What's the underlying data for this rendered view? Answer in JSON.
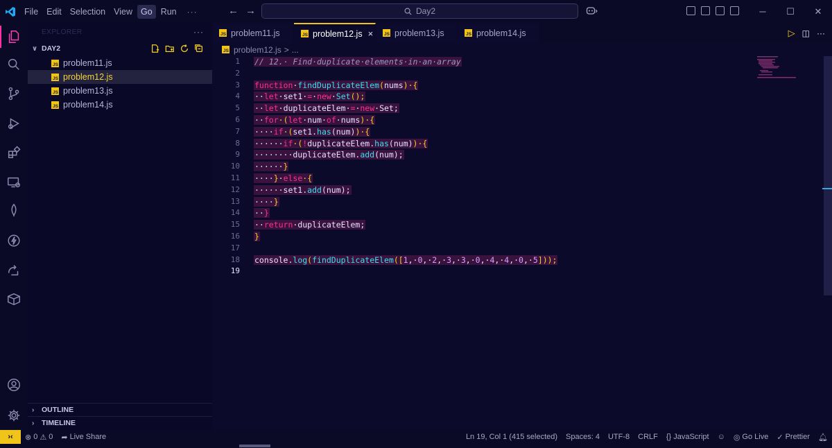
{
  "window": {
    "menu": [
      "File",
      "Edit",
      "Selection",
      "View",
      "Go",
      "Run"
    ],
    "active_menu": "Go",
    "more": "···",
    "search_text": "Day2",
    "nav_back": "←",
    "nav_forward": "→"
  },
  "sidebar": {
    "header_title": "EXPLORER",
    "more": "···",
    "folder_name": "DAY2",
    "files": [
      {
        "name": "problem11.js",
        "selected": false
      },
      {
        "name": "problem12.js",
        "selected": true
      },
      {
        "name": "problem13.js",
        "selected": false
      },
      {
        "name": "problem14.js",
        "selected": false
      }
    ],
    "outline_label": "OUTLINE",
    "timeline_label": "TIMELINE"
  },
  "tabs": [
    {
      "name": "problem11.js",
      "active": false
    },
    {
      "name": "problem12.js",
      "active": true
    },
    {
      "name": "problem13.js",
      "active": false
    },
    {
      "name": "problem14.js",
      "active": false
    }
  ],
  "tab_close": "×",
  "breadcrumb": {
    "file": "problem12.js",
    "sep": ">",
    "rest": "..."
  },
  "editor": {
    "current_line": 19,
    "line_numbers": [
      "1",
      "2",
      "3",
      "4",
      "5",
      "6",
      "7",
      "8",
      "9",
      "10",
      "11",
      "12",
      "13",
      "14",
      "15",
      "16",
      "17",
      "18",
      "19"
    ],
    "lines": [
      [
        {
          "t": "// 12.· Find·duplicate·elements·in·an·array",
          "c": "cmt"
        }
      ],
      [],
      [
        {
          "t": "function",
          "c": "kw"
        },
        {
          "t": "·",
          "c": "id"
        },
        {
          "t": "findDuplicateElem",
          "c": "fn"
        },
        {
          "t": "(",
          "c": "pun"
        },
        {
          "t": "nums",
          "c": "id"
        },
        {
          "t": ")",
          "c": "pun"
        },
        {
          "t": "·{",
          "c": "pun"
        }
      ],
      [
        {
          "t": "··",
          "c": "id"
        },
        {
          "t": "let",
          "c": "kw"
        },
        {
          "t": "·set1·",
          "c": "id"
        },
        {
          "t": "=",
          "c": "op"
        },
        {
          "t": "·",
          "c": "id"
        },
        {
          "t": "new",
          "c": "kw"
        },
        {
          "t": "·",
          "c": "id"
        },
        {
          "t": "Set",
          "c": "fn"
        },
        {
          "t": "();",
          "c": "pun"
        }
      ],
      [
        {
          "t": "··",
          "c": "id"
        },
        {
          "t": "let",
          "c": "kw"
        },
        {
          "t": "·duplicateElem·",
          "c": "id"
        },
        {
          "t": "=",
          "c": "op"
        },
        {
          "t": "·",
          "c": "id"
        },
        {
          "t": "new",
          "c": "kw"
        },
        {
          "t": "·Set;",
          "c": "id"
        }
      ],
      [
        {
          "t": "··",
          "c": "id"
        },
        {
          "t": "for",
          "c": "kw"
        },
        {
          "t": "·(",
          "c": "pun"
        },
        {
          "t": "let",
          "c": "kw"
        },
        {
          "t": "·num·",
          "c": "id"
        },
        {
          "t": "of",
          "c": "kw"
        },
        {
          "t": "·nums",
          "c": "id"
        },
        {
          "t": ")·{",
          "c": "pun"
        }
      ],
      [
        {
          "t": "····",
          "c": "id"
        },
        {
          "t": "if",
          "c": "kw"
        },
        {
          "t": "·(",
          "c": "pun"
        },
        {
          "t": "set1.",
          "c": "id"
        },
        {
          "t": "has",
          "c": "fn"
        },
        {
          "t": "(num)",
          "c": "id"
        },
        {
          "t": ")·{",
          "c": "pun"
        }
      ],
      [
        {
          "t": "······",
          "c": "id"
        },
        {
          "t": "if",
          "c": "kw"
        },
        {
          "t": "·(",
          "c": "pun"
        },
        {
          "t": "!",
          "c": "op"
        },
        {
          "t": "duplicateElem.",
          "c": "id"
        },
        {
          "t": "has",
          "c": "fn"
        },
        {
          "t": "(num)",
          "c": "id"
        },
        {
          "t": ")·{",
          "c": "pun"
        }
      ],
      [
        {
          "t": "········duplicateElem.",
          "c": "id"
        },
        {
          "t": "add",
          "c": "fn"
        },
        {
          "t": "(num);",
          "c": "id"
        }
      ],
      [
        {
          "t": "······",
          "c": "id"
        },
        {
          "t": "}",
          "c": "pun"
        }
      ],
      [
        {
          "t": "····",
          "c": "id"
        },
        {
          "t": "}",
          "c": "pun"
        },
        {
          "t": "·",
          "c": "id"
        },
        {
          "t": "else",
          "c": "kw"
        },
        {
          "t": "·{",
          "c": "pun"
        }
      ],
      [
        {
          "t": "······set1.",
          "c": "id"
        },
        {
          "t": "add",
          "c": "fn"
        },
        {
          "t": "(num);",
          "c": "id"
        }
      ],
      [
        {
          "t": "····",
          "c": "id"
        },
        {
          "t": "}",
          "c": "pun"
        }
      ],
      [
        {
          "t": "··",
          "c": "id"
        },
        {
          "t": "}",
          "c": "op"
        }
      ],
      [
        {
          "t": "··",
          "c": "id"
        },
        {
          "t": "return",
          "c": "kw"
        },
        {
          "t": "·duplicateElem;",
          "c": "id"
        }
      ],
      [
        {
          "t": "}",
          "c": "pun"
        }
      ],
      [],
      [
        {
          "t": "console.",
          "c": "id"
        },
        {
          "t": "log",
          "c": "fn"
        },
        {
          "t": "(",
          "c": "pun"
        },
        {
          "t": "findDuplicateElem",
          "c": "fn"
        },
        {
          "t": "([",
          "c": "pun"
        },
        {
          "t": "1",
          "c": "num"
        },
        {
          "t": ",·",
          "c": "id"
        },
        {
          "t": "0",
          "c": "num"
        },
        {
          "t": ",·",
          "c": "id"
        },
        {
          "t": "2",
          "c": "num"
        },
        {
          "t": ",·",
          "c": "id"
        },
        {
          "t": "3",
          "c": "num"
        },
        {
          "t": ",·",
          "c": "id"
        },
        {
          "t": "3",
          "c": "num"
        },
        {
          "t": ",·",
          "c": "id"
        },
        {
          "t": "0",
          "c": "num"
        },
        {
          "t": ",·",
          "c": "id"
        },
        {
          "t": "4",
          "c": "num"
        },
        {
          "t": ",·",
          "c": "id"
        },
        {
          "t": "4",
          "c": "num"
        },
        {
          "t": ",·",
          "c": "id"
        },
        {
          "t": "0",
          "c": "num"
        },
        {
          "t": ",·",
          "c": "id"
        },
        {
          "t": "5",
          "c": "num"
        },
        {
          "t": "]));",
          "c": "pun"
        }
      ],
      []
    ]
  },
  "statusbar": {
    "remote": "›‹",
    "errors": "0",
    "warnings": "0",
    "live_share": "Live Share",
    "cursor": "Ln 19, Col 1 (415 selected)",
    "spaces": "Spaces: 4",
    "encoding": "UTF-8",
    "eol": "CRLF",
    "language": "JavaScript",
    "go_live": "Go Live",
    "prettier": "Prettier"
  },
  "colors": {
    "accent": "#ff2fa5",
    "selection_bg": "#3a123e",
    "tab_indicator": "#f0c419"
  }
}
